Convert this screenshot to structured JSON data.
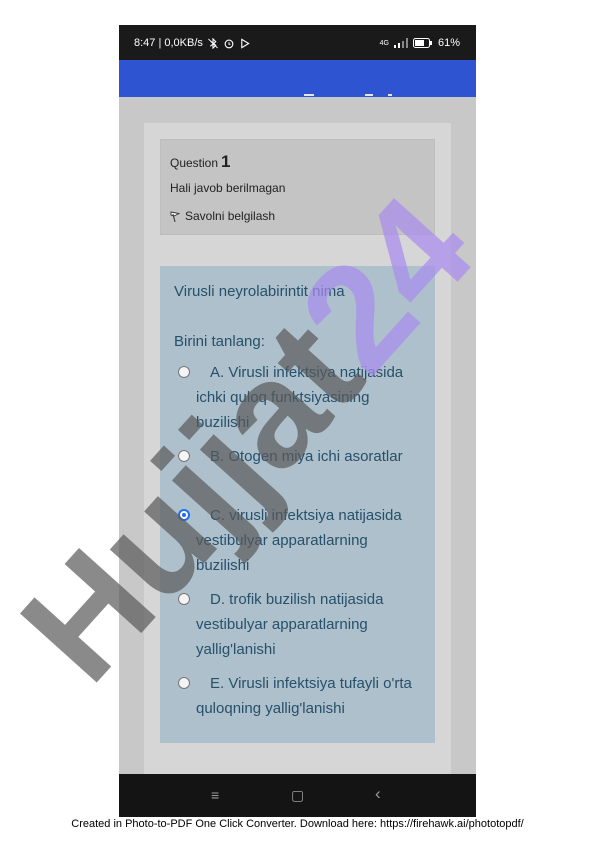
{
  "status_bar": {
    "time_speed": "8:47 | 0,0KB/s",
    "network": "4G",
    "battery": "61%"
  },
  "quiz": {
    "question_label": "Question",
    "question_number": "1",
    "state": "Hali javob berilmagan",
    "flag_label": "Savolni belgilash",
    "question_text": "Virusli neyrolabirintit nima",
    "prompt": "Birini tanlang:",
    "options": [
      {
        "label": "A. Virusli infektsiya natijasida ichki quloq funktsiyasining buzilishi",
        "selected": false
      },
      {
        "label": "B. Otogen miya ichi asoratlar",
        "selected": false
      },
      {
        "label": "C. virusli infektsiya natijasida vestibulyar apparatlarning buzilishi",
        "selected": true
      },
      {
        "label": "D. trofik buzilish natijasida vestibulyar apparatlarning yallig'lanishi",
        "selected": false
      },
      {
        "label": "E. Virusli infektsiya tufayli o'rta quloqning yallig'lanishi",
        "selected": false
      }
    ]
  },
  "nav": {
    "menu": "≡",
    "home": "▢",
    "back": "‹"
  },
  "watermark": {
    "text": "Hujjat24",
    "colors": {
      "dark": "#5a5a5a",
      "accent": "#a98cf0"
    }
  },
  "footer": "Created in Photo-to-PDF One Click Converter. Download here: https://firehawk.ai/phototopdf/",
  "colors": {
    "appbar": "#2e54d2",
    "question_box": "#aec0cb",
    "question_text": "#26506b",
    "radio_selected": "#1e6ef0"
  }
}
